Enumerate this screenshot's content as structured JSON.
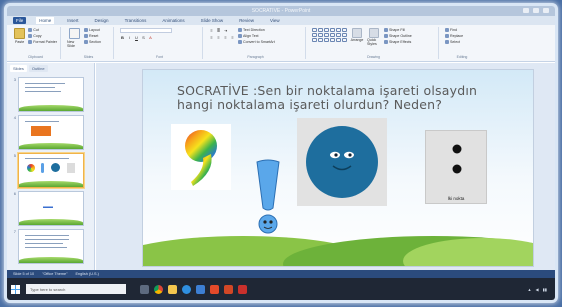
{
  "window": {
    "title": "SOCRATIVE - PowerPoint"
  },
  "ribbon_tabs": [
    "File",
    "Home",
    "Insert",
    "Design",
    "Transitions",
    "Animations",
    "Slide Show",
    "Review",
    "View"
  ],
  "ribbon_groups": {
    "clipboard": {
      "name": "Clipboard",
      "paste": "Paste",
      "cut": "Cut",
      "copy": "Copy",
      "format_painter": "Format Painter"
    },
    "slides": {
      "name": "Slides",
      "new_slide": "New Slide",
      "layout": "Layout",
      "reset": "Reset",
      "section": "Section"
    },
    "font": {
      "name": "Font"
    },
    "paragraph": {
      "name": "Paragraph",
      "text_direction": "Text Direction",
      "align_text": "Align Text",
      "convert_smartart": "Convert to SmartArt"
    },
    "drawing": {
      "name": "Drawing",
      "arrange": "Arrange",
      "quick_styles": "Quick Styles",
      "shape_fill": "Shape Fill",
      "shape_outline": "Shape Outline",
      "shape_effects": "Shape Effects"
    },
    "editing": {
      "name": "Editing",
      "find": "Find",
      "replace": "Replace",
      "select": "Select"
    }
  },
  "panel_tabs": [
    "Slides",
    "Outline"
  ],
  "thumbnails": [
    {
      "num": "3"
    },
    {
      "num": "4"
    },
    {
      "num": "5"
    },
    {
      "num": "6"
    },
    {
      "num": "7"
    }
  ],
  "slide": {
    "title_line1": "SOCRATİVE :Sen bir noktalama işareti olsaydın",
    "title_line2": "hangi noktalama işareti olurdun? Neden?",
    "colon_caption": "İki nokta"
  },
  "status": {
    "slide_of": "Slide 5 of 10",
    "theme": "\"Office Theme\"",
    "language": "English (U.S.)"
  },
  "taskbar": {
    "search_placeholder": "Type here to search"
  },
  "colors": {
    "accent": "#2b579a",
    "circle": "#1e6e9e",
    "grass": "#6db23a"
  }
}
